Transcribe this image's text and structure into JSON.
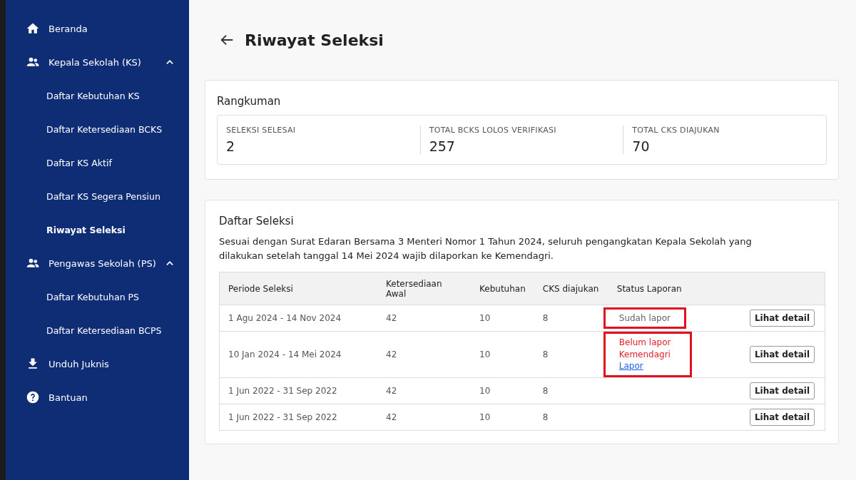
{
  "sidebar": {
    "items": [
      {
        "kind": "home",
        "label": "Beranda",
        "selected": false
      },
      {
        "kind": "group",
        "label": "Kepala Sekolah (KS)",
        "expanded": true,
        "children": [
          {
            "label": "Daftar Kebutuhan KS",
            "selected": false
          },
          {
            "label": "Daftar Ketersediaan BCKS",
            "selected": false
          },
          {
            "label": "Daftar KS Aktif",
            "selected": false
          },
          {
            "label": "Daftar KS Segera Pensiun",
            "selected": false
          },
          {
            "label": "Riwayat Seleksi",
            "selected": true
          }
        ]
      },
      {
        "kind": "group",
        "label": "Pengawas Sekolah (PS)",
        "expanded": true,
        "children": [
          {
            "label": "Daftar Kebutuhan PS",
            "selected": false
          },
          {
            "label": "Daftar Ketersediaan BCPS",
            "selected": false
          }
        ]
      },
      {
        "kind": "download",
        "label": "Unduh Juknis",
        "selected": false
      },
      {
        "kind": "help",
        "label": "Bantuan",
        "selected": false
      }
    ]
  },
  "page": {
    "title": "Riwayat Seleksi"
  },
  "summary": {
    "title": "Rangkuman",
    "stats": [
      {
        "label": "SELEKSI SELESAI",
        "value": "2"
      },
      {
        "label": "TOTAL BCKS LOLOS VERIFIKASI",
        "value": "257"
      },
      {
        "label": "TOTAL CKS DIAJUKAN",
        "value": "70"
      }
    ]
  },
  "selection_list": {
    "title": "Daftar Seleksi",
    "description": "Sesuai dengan Surat Edaran Bersama 3 Menteri Nomor 1 Tahun 2024, seluruh pengangkatan Kepala Sekolah yang dilakukan setelah tanggal 14 Mei 2024 wajib dilaporkan ke Kemendagri.",
    "table": {
      "columns": [
        "Periode Seleksi",
        "Ketersediaan Awal",
        "Kebutuhan",
        "CKS diajukan",
        "Status Laporan"
      ],
      "rows": [
        {
          "period": "1 Agu 2024 - 14 Nov 2024",
          "initial": "42",
          "need": "10",
          "submitted": "8",
          "status": {
            "kind": "reported",
            "text": "Sudah lapor",
            "highlighted": true
          },
          "action": "Lihat detail"
        },
        {
          "period": "10 Jan 2024 - 14 Mei 2024",
          "initial": "42",
          "need": "10",
          "submitted": "8",
          "status": {
            "kind": "unreported",
            "text": "Belum lapor Kemendagri",
            "link": "Lapor",
            "highlighted": true
          },
          "action": "Lihat detail"
        },
        {
          "period": "1 Jun 2022 - 31 Sep 2022",
          "initial": "42",
          "need": "10",
          "submitted": "8",
          "action": "Lihat detail"
        },
        {
          "period": "1 Jun 2022 - 31 Sep 2022",
          "initial": "42",
          "need": "10",
          "submitted": "8",
          "action": "Lihat detail"
        }
      ]
    }
  }
}
